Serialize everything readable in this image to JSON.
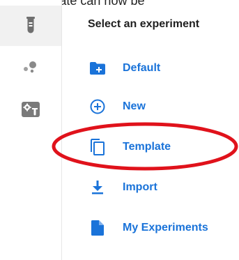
{
  "caption": "Your template can now be",
  "panel": {
    "title": "Select an experiment"
  },
  "rail": {
    "items": [
      {
        "icon": "test-tube-icon",
        "active": true
      },
      {
        "icon": "dots-cluster-icon",
        "active": false
      },
      {
        "icon": "gear-flask-icon",
        "active": false
      }
    ]
  },
  "menu": {
    "items": [
      {
        "label": "Default",
        "icon": "folder-plus-icon"
      },
      {
        "label": "New",
        "icon": "plus-circle-icon"
      },
      {
        "label": "Template",
        "icon": "copy-icon"
      },
      {
        "label": "Import",
        "icon": "download-icon"
      },
      {
        "label": "My Experiments",
        "icon": "file-icon"
      }
    ]
  },
  "colors": {
    "accent": "#1a73d9",
    "rail_icon": "#6f6f6f",
    "highlight": "#e0121b",
    "rail_active_bg": "#f1f1f1"
  }
}
